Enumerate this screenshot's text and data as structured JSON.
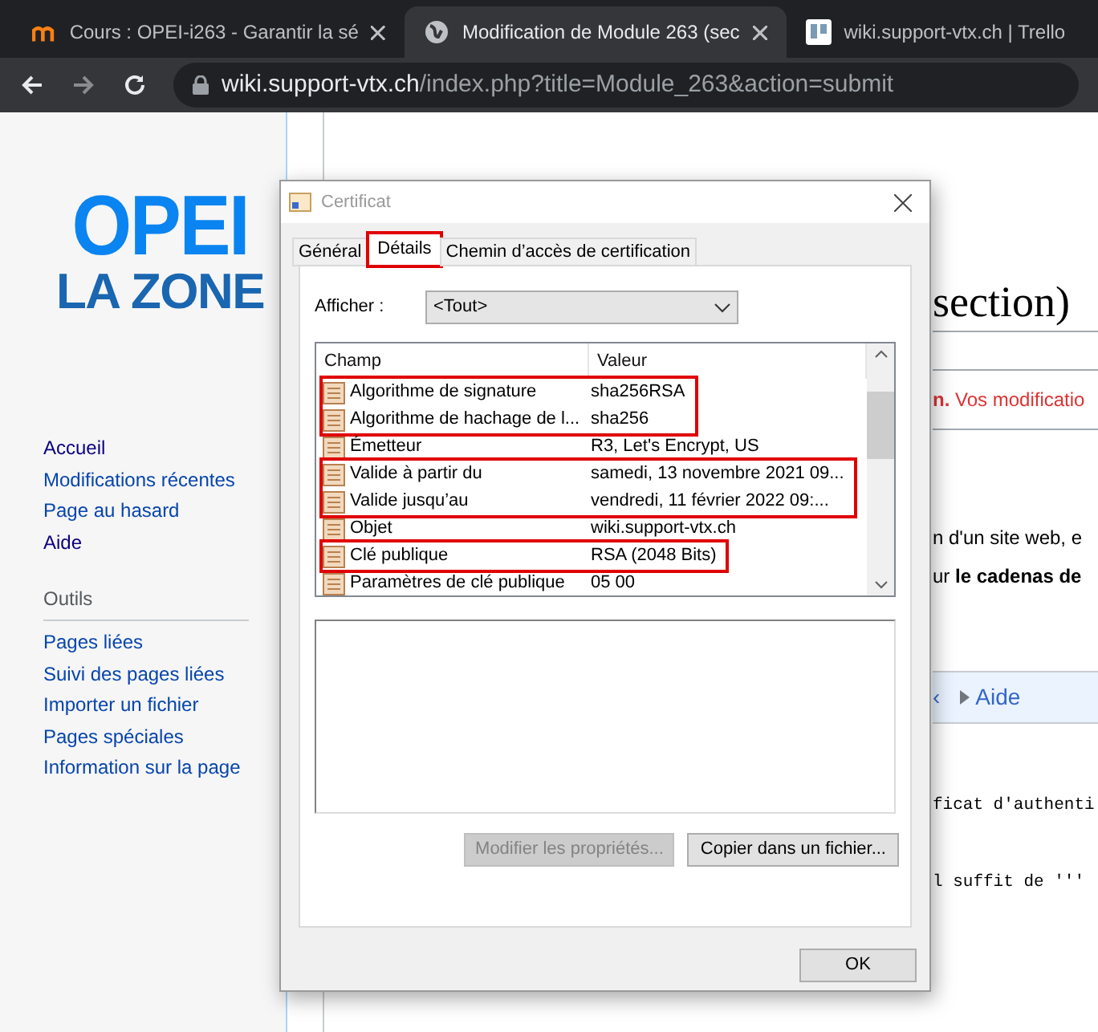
{
  "browser": {
    "tabs": [
      {
        "title": "Cours : OPEI-i263 - Garantir la sé",
        "selected": false
      },
      {
        "title": "Modification de Module 263 (sec",
        "selected": true
      },
      {
        "title": "wiki.support-vtx.ch | Trello",
        "selected": false
      }
    ],
    "address": {
      "host": "wiki.support-vtx.ch",
      "path": "/index.php?title=Module_263&action=submit"
    }
  },
  "wiki": {
    "logo": {
      "line_1": "OPEI",
      "line_2": "LA ZONE"
    },
    "navigation": [
      "Accueil",
      "Modifications récentes",
      "Page au hasard",
      "Aide"
    ],
    "tools_heading": "Outils",
    "tools": [
      "Pages liées",
      "Suivi des pages liées",
      "Importer un fichier",
      "Pages spéciales",
      "Information sur la page"
    ],
    "heading": "section)",
    "warning": {
      "bold": "n.",
      "text": "Vos modificatio"
    },
    "paragraphs": [
      "n d'un site web, e",
      "ur **le cadenas de**"
    ],
    "toolbar": {
      "item_1": "‹",
      "item_2": "Aide"
    },
    "code_lines": [
      "ficat d'authenti",
      "l suffit de '''"
    ]
  },
  "dialog": {
    "title": "Certificat",
    "tabs": [
      {
        "label": "Général",
        "selected": false,
        "highlighted": false
      },
      {
        "label": "Détails",
        "selected": true,
        "highlighted": true
      },
      {
        "label": "Chemin d’accès de certification",
        "selected": false,
        "highlighted": false
      }
    ],
    "show_label": "Afficher :",
    "show_value": "<Tout>",
    "columns": [
      "Champ",
      "Valeur"
    ],
    "field_groups": [
      {
        "highlighted": true,
        "rows": [
          {
            "field": "Algorithme de signature",
            "value": "sha256RSA"
          },
          {
            "field": "Algorithme de hachage de l...",
            "value": "sha256"
          }
        ]
      },
      {
        "highlighted": false,
        "rows": [
          {
            "field": "Émetteur",
            "value": "R3, Let's Encrypt, US"
          }
        ]
      },
      {
        "highlighted": true,
        "rows": [
          {
            "field": "Valide à partir du",
            "value": "samedi, 13 novembre 2021 09..."
          },
          {
            "field": "Valide jusqu’au",
            "value": "vendredi, 11 février 2022 09:..."
          }
        ]
      },
      {
        "highlighted": false,
        "rows": [
          {
            "field": "Objet",
            "value": "wiki.support-vtx.ch"
          }
        ]
      },
      {
        "highlighted": true,
        "rows": [
          {
            "field": "Clé publique",
            "value": "RSA (2048 Bits)"
          }
        ]
      },
      {
        "highlighted": false,
        "rows": [
          {
            "field": "Paramètres de clé publique",
            "value": "05 00"
          }
        ]
      }
    ],
    "buttons": [
      {
        "label": "Modifier les propriétés...",
        "disabled": true
      },
      {
        "label": "Copier dans un fichier...",
        "disabled": false
      }
    ],
    "ok": "OK"
  }
}
